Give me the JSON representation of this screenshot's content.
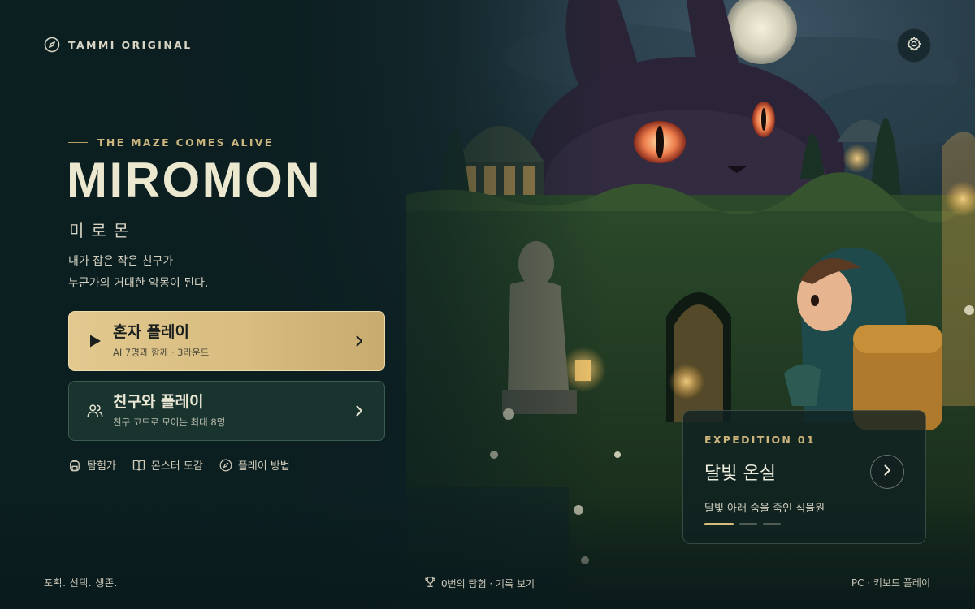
{
  "brand": {
    "name": "TAMMI ORIGINAL",
    "icon": "compass-icon"
  },
  "settings": {
    "icon": "gear-icon"
  },
  "hero": {
    "tagline": "THE MAZE COMES ALIVE",
    "title": "MIROMON",
    "subtitle_ko": "미로몬",
    "description": [
      "내가 잡은 작은 친구가",
      "누군가의 거대한 악몽이 된다."
    ]
  },
  "actions": {
    "solo": {
      "label": "혼자 플레이",
      "sub": "AI 7명과 함께 · 3라운드",
      "icon": "play-icon",
      "accent": "#dcc187"
    },
    "friends": {
      "label": "친구와 플레이",
      "sub": "친구 코드로 모이는 최대 8명",
      "icon": "users-icon"
    }
  },
  "quick_links": [
    {
      "label": "탐험가",
      "icon": "backpack-icon"
    },
    {
      "label": "몬스터 도감",
      "icon": "book-icon"
    },
    {
      "label": "플레이 방법",
      "icon": "compass-icon"
    }
  ],
  "expedition": {
    "kicker": "EXPEDITION 01",
    "title": "달빛 온실",
    "desc": "달빛 아래 숨을 죽인 식물원",
    "pages": 3,
    "active_page": 1
  },
  "footer": {
    "left": "포획. 선택. 생존.",
    "center": "0번의 탐험 · 기록 보기",
    "center_icon": "trophy-icon",
    "right": "PC · 키보드 플레이"
  },
  "colors": {
    "background": "#0d1f22",
    "gold": "#cdb67d",
    "title": "#ebe8cf"
  }
}
